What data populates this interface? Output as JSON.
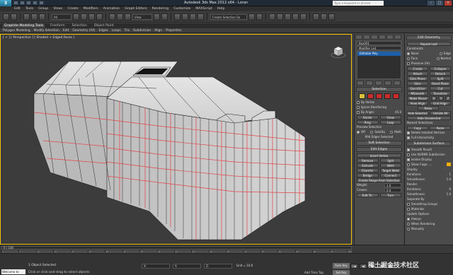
{
  "window": {
    "title": "Autodesk 3ds Max 2012 x64 - Loran",
    "search_placeholder": "Type a keyword or phrase",
    "app_logo": "3"
  },
  "menu": [
    "Edit",
    "Tools",
    "Group",
    "Views",
    "Create",
    "Modifiers",
    "Animation",
    "Graph Editors",
    "Rendering",
    "Customize",
    "MAXScript",
    "Help"
  ],
  "toolbar": {
    "selection_filter": "All",
    "view_dropdown": "View",
    "named_sel": "Create Selection Se"
  },
  "ribbon": {
    "tabs": [
      "Graphite Modeling Tools",
      "Freeform",
      "Selection",
      "Object Paint"
    ],
    "sub": [
      "Polygon Modeling",
      "Modify Selection",
      "Edit",
      "Geometry (All)",
      "Edges",
      "Loops",
      "Tris",
      "Subdivision",
      "Align",
      "Properties"
    ]
  },
  "viewport": {
    "label": "[ + ] [ Perspective ] [ Shaded + Edged Faces ]"
  },
  "panel_mid": {
    "object_name": "Box001",
    "modifier_list": "Modifier List",
    "stack_item": "Editable Poly",
    "selection_title": "Selection",
    "by_vertex": "By Vertex",
    "ignore_backfacing": "Ignore Backfacing",
    "by_angle": "By Angle:",
    "by_angle_val": "45.0",
    "shrink": "Shrink",
    "grow": "Grow",
    "ring": "Ring",
    "loop": "Loop",
    "preview_title": "Preview Selection",
    "preview_off": "Off",
    "preview_subobj": "SubObj",
    "preview_multi": "Multi",
    "selected_count": "994 Edges Selected",
    "soft_selection": "Soft Selection",
    "edit_edges": "Edit Edges",
    "insert_vertex": "Insert Vertex",
    "remove": "Remove",
    "split": "Split",
    "extrude": "Extrude",
    "weld": "Weld",
    "chamfer": "Chamfer",
    "target_weld": "Target Weld",
    "bridge": "Bridge",
    "connect": "Connect",
    "create_shape": "Create Shape From Selection",
    "weight_label": "Weight:",
    "weight_val": "1.0",
    "crease_label": "Crease:",
    "crease_val": "0.0",
    "edit_tri": "Edit Tri.",
    "turn": "Turn"
  },
  "panel_right": {
    "edit_geometry": "Edit Geometry",
    "repeat_last": "Repeat Last",
    "constraints": "Constraints",
    "c_none": "None",
    "c_edge": "Edge",
    "c_face": "Face",
    "c_normal": "Normal",
    "preserve_uvs": "Preserve UVs",
    "create": "Create",
    "collapse": "Collapse",
    "attach": "Attach",
    "detach": "Detach",
    "slice_plane": "Slice Plane",
    "split": "Split",
    "slice": "Slice",
    "reset_plane": "Reset Plane",
    "quickslice": "QuickSlice",
    "cut": "Cut",
    "msmooth": "MSmooth",
    "tessellate": "Tessellate",
    "make_planar": "Make Planar",
    "x": "X",
    "y": "Y",
    "z": "Z",
    "view_align": "View Align",
    "grid_align": "Grid Align",
    "relax": "Relax",
    "hide_selected": "Hide Selected",
    "unhide_all": "Unhide All",
    "hide_unselected": "Hide Unselected",
    "named_selections": "Named Selections:",
    "copy": "Copy",
    "paste": "Paste",
    "delete_isolated": "Delete Isolated Vertices",
    "full_interactivity": "Full Interactivity",
    "subdivision_surface": "Subdivision Surface",
    "smooth_result": "Smooth Result",
    "use_nurms": "Use NURMS Subdivision",
    "isoline_display": "Isoline Display",
    "show_cage": "Show Cage......",
    "display": "Display",
    "iterations": "Iterations:",
    "iterations_val": "1",
    "smoothness": "Smoothness:",
    "smoothness_val": "1.0",
    "render": "Render",
    "r_iterations_val": "0",
    "r_smoothness_val": "1.0",
    "separate_by": "Separate By",
    "smoothing_groups": "Smoothing Groups",
    "materials": "Materials",
    "update_options": "Update Options",
    "always": "Always",
    "when_rendering": "When Rendering",
    "manually": "Manually"
  },
  "timeline": {
    "slider": "0 / 100",
    "ticks": [
      "0",
      "5",
      "10",
      "15",
      "20",
      "25",
      "30",
      "35",
      "40",
      "45",
      "50",
      "55",
      "60",
      "65",
      "70",
      "75",
      "80",
      "85",
      "90",
      "95",
      "100"
    ]
  },
  "status": {
    "maxscript": "Welcome to MAXScri",
    "selected": "1 Object Selected",
    "prompt": "Click or click-and-drag to select objects",
    "x_val": "X:",
    "y_val": "Y:",
    "z_val": "Z:",
    "grid": "Grid = 10.0",
    "auto_key": "Auto Key",
    "set_key": "Set Key",
    "selected_dd": "Selected",
    "key_filters": "Key Filters...",
    "add_time_tag": "Add Time Tag"
  },
  "watermark": "稀土掘金技术社区",
  "colors": {
    "accent_yellow": "#f5c400",
    "edge_red": "#e0464b",
    "wire": "#2a2a2a",
    "mesh": "#c9c9c9"
  }
}
